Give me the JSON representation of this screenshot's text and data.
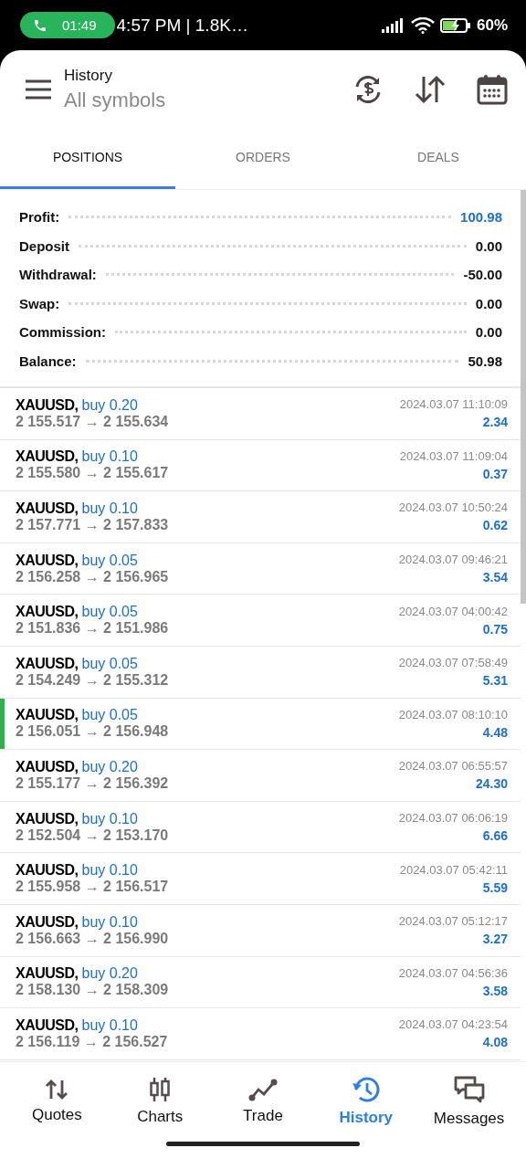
{
  "status_bar": {
    "call_time": "01:49",
    "info": "4:57 PM | 1.8K…",
    "battery": "60%"
  },
  "header": {
    "title": "History",
    "subtitle": "All symbols"
  },
  "tabs": [
    {
      "label": "POSITIONS",
      "selected": true
    },
    {
      "label": "ORDERS",
      "selected": false
    },
    {
      "label": "DEALS",
      "selected": false
    }
  ],
  "summary": [
    {
      "label": "Profit:",
      "value": "100.98",
      "emphasized": true
    },
    {
      "label": "Deposit",
      "value": "0.00",
      "emphasized": false
    },
    {
      "label": "Withdrawal:",
      "value": "-50.00",
      "emphasized": false
    },
    {
      "label": "Swap:",
      "value": "0.00",
      "emphasized": false
    },
    {
      "label": "Commission:",
      "value": "0.00",
      "emphasized": false
    },
    {
      "label": "Balance:",
      "value": "50.98",
      "emphasized": false
    }
  ],
  "positions": [
    {
      "symbol": "XAUUSD,",
      "side": "buy 0.20",
      "prices": "2 155.517 → 2 155.634",
      "time": "2024.03.07 11:10:09",
      "profit": "2.34",
      "selected": false
    },
    {
      "symbol": "XAUUSD,",
      "side": "buy 0.10",
      "prices": "2 155.580 → 2 155.617",
      "time": "2024.03.07 11:09:04",
      "profit": "0.37",
      "selected": false
    },
    {
      "symbol": "XAUUSD,",
      "side": "buy 0.10",
      "prices": "2 157.771 → 2 157.833",
      "time": "2024.03.07 10:50:24",
      "profit": "0.62",
      "selected": false
    },
    {
      "symbol": "XAUUSD,",
      "side": "buy 0.05",
      "prices": "2 156.258 → 2 156.965",
      "time": "2024.03.07 09:46:21",
      "profit": "3.54",
      "selected": false
    },
    {
      "symbol": "XAUUSD,",
      "side": "buy 0.05",
      "prices": "2 151.836 → 2 151.986",
      "time": "2024.03.07 04:00:42",
      "profit": "0.75",
      "selected": false
    },
    {
      "symbol": "XAUUSD,",
      "side": "buy 0.05",
      "prices": "2 154.249 → 2 155.312",
      "time": "2024.03.07 07:58:49",
      "profit": "5.31",
      "selected": false
    },
    {
      "symbol": "XAUUSD,",
      "side": "buy 0.05",
      "prices": "2 156.051 → 2 156.948",
      "time": "2024.03.07 08:10:10",
      "profit": "4.48",
      "selected": true
    },
    {
      "symbol": "XAUUSD,",
      "side": "buy 0.20",
      "prices": "2 155.177 → 2 156.392",
      "time": "2024.03.07 06:55:57",
      "profit": "24.30",
      "selected": false
    },
    {
      "symbol": "XAUUSD,",
      "side": "buy 0.10",
      "prices": "2 152.504 → 2 153.170",
      "time": "2024.03.07 06:06:19",
      "profit": "6.66",
      "selected": false
    },
    {
      "symbol": "XAUUSD,",
      "side": "buy 0.10",
      "prices": "2 155.958 → 2 156.517",
      "time": "2024.03.07 05:42:11",
      "profit": "5.59",
      "selected": false
    },
    {
      "symbol": "XAUUSD,",
      "side": "buy 0.10",
      "prices": "2 156.663 → 2 156.990",
      "time": "2024.03.07 05:12:17",
      "profit": "3.27",
      "selected": false
    },
    {
      "symbol": "XAUUSD,",
      "side": "buy 0.20",
      "prices": "2 158.130 → 2 158.309",
      "time": "2024.03.07 04:56:36",
      "profit": "3.58",
      "selected": false
    },
    {
      "symbol": "XAUUSD,",
      "side": "buy 0.10",
      "prices": "2 156.119 → 2 156.527",
      "time": "2024.03.07 04:23:54",
      "profit": "4.08",
      "selected": false
    }
  ],
  "bottom_nav": [
    {
      "label": "Quotes",
      "selected": false
    },
    {
      "label": "Charts",
      "selected": false
    },
    {
      "label": "Trade",
      "selected": false
    },
    {
      "label": "History",
      "selected": true
    },
    {
      "label": "Messages",
      "selected": false
    }
  ]
}
